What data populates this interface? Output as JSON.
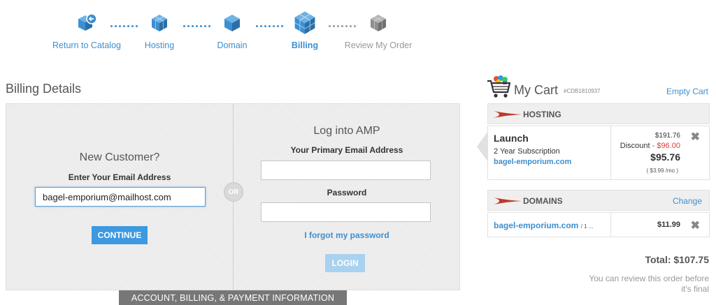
{
  "steps": [
    {
      "label": "Return to Catalog",
      "state": "done",
      "icon": "catalog-back-cube-icon"
    },
    {
      "label": "Hosting",
      "state": "done",
      "icon": "cube-icon"
    },
    {
      "label": "Domain",
      "state": "done",
      "icon": "cube-icon"
    },
    {
      "label": "Billing",
      "state": "active",
      "icon": "cube-icon"
    },
    {
      "label": "Review My Order",
      "state": "future",
      "icon": "cube-icon"
    }
  ],
  "billing": {
    "title": "Billing Details",
    "new_customer": {
      "title": "New Customer?",
      "email_label": "Enter Your Email Address",
      "email_value": "bagel-emporium@mailhost.com",
      "continue_label": "CONTINUE"
    },
    "or_label": "OR",
    "login": {
      "title": "Log into AMP",
      "email_label": "Your Primary Email Address",
      "email_value": "",
      "password_label": "Password",
      "password_value": "",
      "forgot_label": "I forgot my password",
      "login_label": "LOGIN"
    },
    "footer_tab": "ACCOUNT, BILLING, & PAYMENT INFORMATION"
  },
  "cart": {
    "title": "My Cart",
    "id": "#CDB1810937",
    "empty_label": "Empty Cart",
    "hosting": {
      "section_title": "HOSTING",
      "plan": "Launch",
      "term": "2 Year Subscription",
      "domain": "bagel-emporium.com",
      "price": "$191.76",
      "discount_label": "Discount",
      "discount_value": "- $96.00",
      "final_price": "$95.76",
      "monthly": "( $3.99 /mo )"
    },
    "domains": {
      "section_title": "DOMAINS",
      "change_label": "Change",
      "domain": "bagel-emporium.com",
      "term": "/ 1 ...",
      "price": "$11.99"
    },
    "remove_glyph": "✖",
    "total": "Total: $107.75",
    "review_note": "You can review this order before it's final"
  },
  "colors": {
    "accent": "#3d8fd1",
    "button": "#3d99e0",
    "button_disabled": "#a9d1f0",
    "discount": "#e53935",
    "swoosh": "#c0392b"
  }
}
